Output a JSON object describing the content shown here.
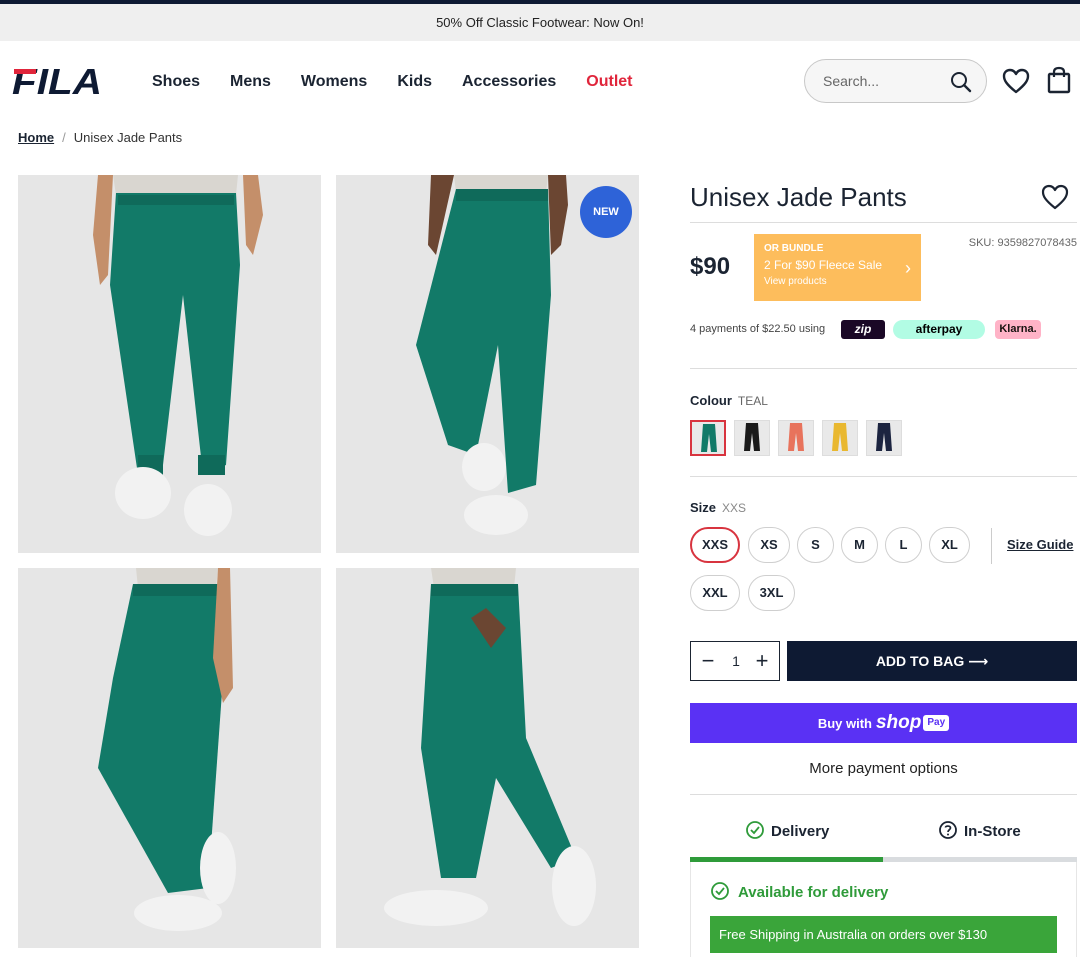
{
  "announcement": "50% Off Classic Footwear: Now On!",
  "header": {
    "logo_text": "FILA",
    "nav": [
      "Shoes",
      "Mens",
      "Womens",
      "Kids",
      "Accessories",
      "Outlet"
    ],
    "search_placeholder": "Search..."
  },
  "breadcrumb": {
    "home": "Home",
    "current": "Unisex Jade Pants"
  },
  "gallery": {
    "badge": "NEW"
  },
  "product": {
    "title": "Unisex Jade Pants",
    "price": "$90",
    "sku": "SKU: 9359827078435",
    "bundle": {
      "line1": "OR BUNDLE",
      "line2": "2 For $90 Fleece Sale",
      "line3": "View products"
    },
    "installments": "4 payments of $22.50 using",
    "pay_providers": [
      "zip",
      "afterpay",
      "Klarna."
    ],
    "colour": {
      "label": "Colour",
      "selected": "TEAL",
      "swatches": [
        "#127a68",
        "#1a1a1a",
        "#e8735c",
        "#e9b830",
        "#1c2440"
      ]
    },
    "size": {
      "label": "Size",
      "selected": "XXS",
      "options": [
        "XXS",
        "XS",
        "S",
        "M",
        "L",
        "XL",
        "XXL",
        "3XL"
      ],
      "guide": "Size Guide"
    },
    "quantity": "1",
    "add_to_bag": "ADD TO BAG ⟶",
    "shop_pay": {
      "buy_with": "Buy with",
      "shop": "shop",
      "pay": "Pay"
    },
    "more_payment": "More payment options",
    "tabs": [
      "Delivery",
      "In-Store"
    ],
    "availability": "Available for delivery",
    "free_shipping": "Free Shipping in Australia on orders over $130"
  },
  "colors": {
    "navy": "#0e1a33",
    "outlet_red": "#e0253b",
    "shop_purple": "#5a31f4",
    "green": "#2f9b3a",
    "bundle_orange": "#fdbd5c",
    "pants_teal": "#127a68"
  }
}
